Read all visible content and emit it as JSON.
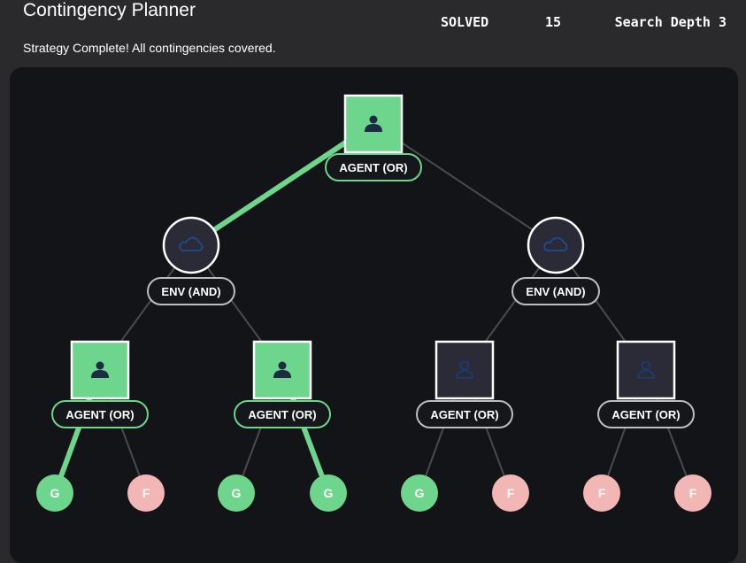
{
  "header": {
    "title": "Contingency Planner",
    "subtitle": "Strategy Complete! All contingencies covered."
  },
  "stats": {
    "status": "SOLVED",
    "count": "15",
    "depth_label": "Search Depth 3"
  },
  "colors": {
    "background": "#2a2a2d",
    "panel": "#131418",
    "success": "#6dd58c",
    "failure": "#f2b6b4",
    "inactive_node": "#2b2b37",
    "edge": "#4a4a4f",
    "icon_dark": "#1f2a44"
  },
  "tree": {
    "root": {
      "label": "AGENT (OR)",
      "type": "agent",
      "solved": true
    },
    "env_nodes": [
      {
        "label": "ENV (AND)",
        "type": "env",
        "on_path": true
      },
      {
        "label": "ENV (AND)",
        "type": "env",
        "on_path": false
      }
    ],
    "agent_nodes": [
      {
        "label": "AGENT (OR)",
        "type": "agent",
        "solved": true
      },
      {
        "label": "AGENT (OR)",
        "type": "agent",
        "solved": true
      },
      {
        "label": "AGENT (OR)",
        "type": "agent",
        "solved": false
      },
      {
        "label": "AGENT (OR)",
        "type": "agent",
        "solved": false
      }
    ],
    "leaves": [
      {
        "letter": "G",
        "outcome": "goal",
        "on_path": true
      },
      {
        "letter": "F",
        "outcome": "fail",
        "on_path": false
      },
      {
        "letter": "G",
        "outcome": "goal",
        "on_path": false
      },
      {
        "letter": "G",
        "outcome": "goal",
        "on_path": true
      },
      {
        "letter": "G",
        "outcome": "goal",
        "on_path": false
      },
      {
        "letter": "F",
        "outcome": "fail",
        "on_path": false
      },
      {
        "letter": "F",
        "outcome": "fail",
        "on_path": false
      },
      {
        "letter": "F",
        "outcome": "fail",
        "on_path": false
      }
    ]
  }
}
